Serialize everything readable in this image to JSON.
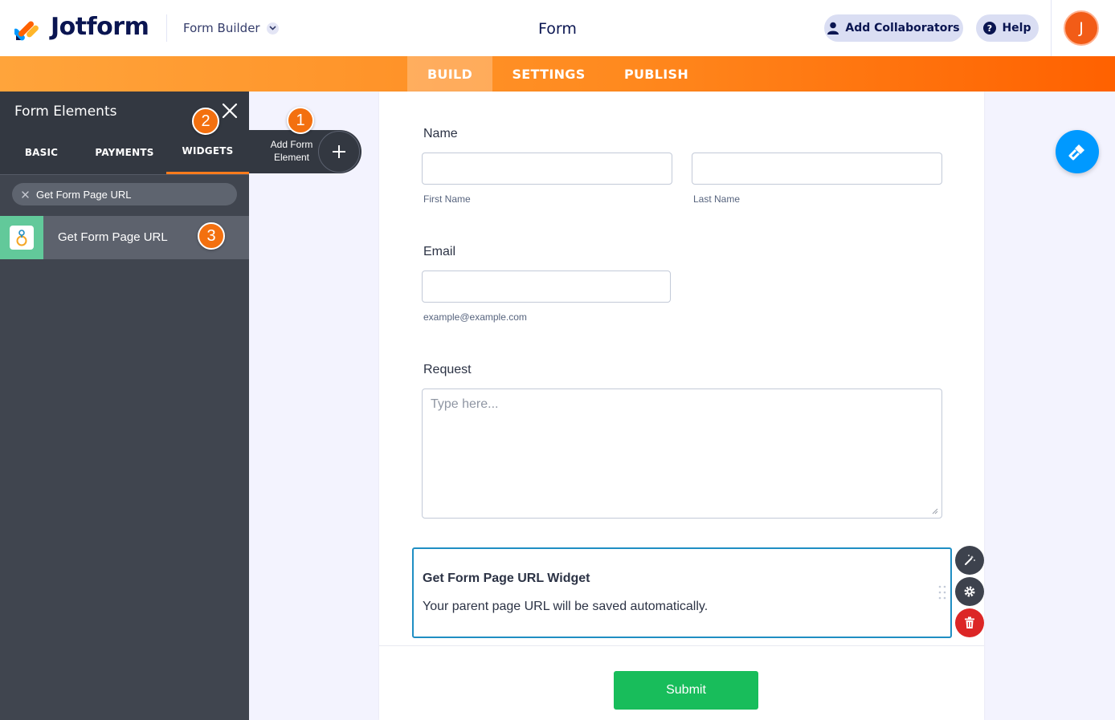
{
  "header": {
    "brand": "Jotform",
    "app_switcher": "Form Builder",
    "form_title": "Form",
    "add_collaborators": "Add Collaborators",
    "help": "Help",
    "avatar_initial": "J"
  },
  "nav": {
    "build": "BUILD",
    "settings": "SETTINGS",
    "publish": "PUBLISH"
  },
  "panel": {
    "title": "Form Elements",
    "tabs": {
      "basic": "BASIC",
      "payments": "PAYMENTS",
      "widgets": "WIDGETS"
    },
    "search_value": "Get Form Page URL",
    "widget_item": "Get Form Page URL"
  },
  "add_element": {
    "label": "Add Form Element"
  },
  "steps": [
    "1",
    "2",
    "3"
  ],
  "form": {
    "name_label": "Name",
    "first_name_sub": "First Name",
    "last_name_sub": "Last Name",
    "email_label": "Email",
    "email_sub": "example@example.com",
    "request_label": "Request",
    "request_placeholder": "Type here...",
    "widget_title": "Get Form Page URL Widget",
    "widget_desc": "Your parent page URL will be saved automatically.",
    "submit": "Submit"
  },
  "colors": {
    "accent_orange": "#ff7b1c",
    "submit_green": "#18bd5b",
    "widget_border": "#1f8ec3",
    "delete_red": "#dc2626",
    "designer_blue": "#0099ff"
  },
  "icons": {
    "logo": "jotform-logo-icon",
    "collaborators": "user-icon",
    "help": "question-icon",
    "close": "close-icon",
    "search_clear": "clear-icon",
    "widget": "get-form-page-url-widget-icon",
    "add": "plus-icon",
    "wand": "wand-icon",
    "gear": "gear-icon",
    "trash": "trash-icon",
    "designer": "paint-roller-icon"
  }
}
